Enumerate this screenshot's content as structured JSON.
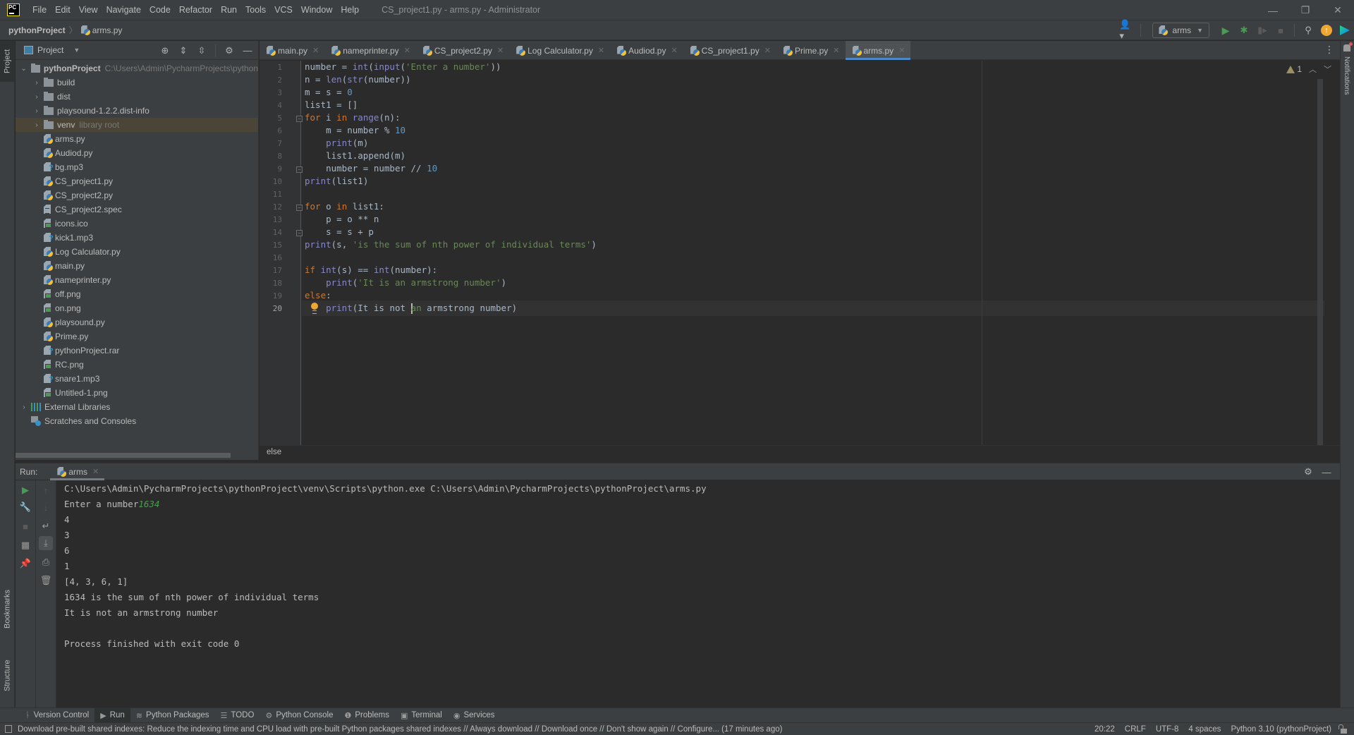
{
  "app": {
    "logo_text": "PC",
    "window_title": "CS_project1.py - arms.py - Administrator",
    "menu": [
      "File",
      "Edit",
      "View",
      "Navigate",
      "Code",
      "Refactor",
      "Run",
      "Tools",
      "VCS",
      "Window",
      "Help"
    ],
    "window_controls": {
      "minimize": "—",
      "restore": "❐",
      "close": "✕"
    }
  },
  "navbar": {
    "project": "pythonProject",
    "file": "arms.py",
    "run_config": "arms",
    "icons": [
      "account-icon",
      "run-icon",
      "debug-icon",
      "coverage-icon",
      "stop-icon",
      "search-icon",
      "update-icon",
      "code-with-me-icon"
    ]
  },
  "side_stripes": {
    "project": "Project",
    "bookmarks": "Bookmarks",
    "structure": "Structure",
    "notifications": "Notifications"
  },
  "project_panel": {
    "title": "Project",
    "root": {
      "name": "pythonProject",
      "path": "C:\\Users\\Admin\\PycharmProjects\\python"
    },
    "folders": [
      {
        "name": "build",
        "hint": ""
      },
      {
        "name": "dist",
        "hint": ""
      },
      {
        "name": "playsound-1.2.2.dist-info",
        "hint": ""
      },
      {
        "name": "venv",
        "hint": "library root"
      }
    ],
    "files": [
      {
        "name": "arms.py",
        "type": "py"
      },
      {
        "name": "Audiod.py",
        "type": "py"
      },
      {
        "name": "bg.mp3",
        "type": "unknown"
      },
      {
        "name": "CS_project1.py",
        "type": "py"
      },
      {
        "name": "CS_project2.py",
        "type": "py"
      },
      {
        "name": "CS_project2.spec",
        "type": "text"
      },
      {
        "name": "icons.ico",
        "type": "image"
      },
      {
        "name": "kick1.mp3",
        "type": "unknown"
      },
      {
        "name": "Log Calculator.py",
        "type": "py"
      },
      {
        "name": "main.py",
        "type": "py"
      },
      {
        "name": "nameprinter.py",
        "type": "py"
      },
      {
        "name": "off.png",
        "type": "image"
      },
      {
        "name": "on.png",
        "type": "image"
      },
      {
        "name": "playsound.py",
        "type": "py"
      },
      {
        "name": "Prime.py",
        "type": "py"
      },
      {
        "name": "pythonProject.rar",
        "type": "unknown"
      },
      {
        "name": "RC.png",
        "type": "image"
      },
      {
        "name": "snare1.mp3",
        "type": "unknown"
      },
      {
        "name": "Untitled-1.png",
        "type": "image"
      }
    ],
    "external_libraries": "External Libraries",
    "scratches": "Scratches and Consoles"
  },
  "editor": {
    "tabs": [
      {
        "label": "main.py",
        "active": false
      },
      {
        "label": "nameprinter.py",
        "active": false
      },
      {
        "label": "CS_project2.py",
        "active": false
      },
      {
        "label": "Log Calculator.py",
        "active": false
      },
      {
        "label": "Audiod.py",
        "active": false
      },
      {
        "label": "CS_project1.py",
        "active": false
      },
      {
        "label": "Prime.py",
        "active": false
      },
      {
        "label": "arms.py",
        "active": true
      }
    ],
    "warnings_count": "1",
    "current_line": 20,
    "lines": [
      "number = int(input('Enter a number'))",
      "n = len(str(number))",
      "m = s = 0",
      "list1 = []",
      "for i in range(n):",
      "    m = number % 10",
      "    print(m)",
      "    list1.append(m)",
      "    number = number // 10",
      "print(list1)",
      "",
      "for o in list1:",
      "    p = o ** n",
      "    s = s + p",
      "print(s, 'is the sum of nth power of individual terms')",
      "",
      "if int(s) == int(number):",
      "    print('It is an armstrong number')",
      "else:",
      "    print('It is not an armstrong number')"
    ],
    "breadcrumb": "else"
  },
  "run_panel": {
    "label": "Run:",
    "tab": "arms",
    "command": "C:\\Users\\Admin\\PycharmProjects\\pythonProject\\venv\\Scripts\\python.exe C:\\Users\\Admin\\PycharmProjects\\pythonProject\\arms.py",
    "prompt": "Enter a number",
    "input_value": "1634",
    "output": [
      "4",
      "3",
      "6",
      "1",
      "[4, 3, 6, 1]",
      "1634 is the sum of nth power of individual terms",
      "It is not an armstrong number",
      "",
      "Process finished with exit code 0"
    ]
  },
  "tool_windows": [
    {
      "label": "Version Control",
      "icon": "ᚿ",
      "active": false
    },
    {
      "label": "Run",
      "icon": "▶",
      "active": true
    },
    {
      "label": "Python Packages",
      "icon": "≋",
      "active": false
    },
    {
      "label": "TODO",
      "icon": "☰",
      "active": false
    },
    {
      "label": "Python Console",
      "icon": "⚙",
      "active": false
    },
    {
      "label": "Problems",
      "icon": "❶",
      "active": false
    },
    {
      "label": "Terminal",
      "icon": "▣",
      "active": false
    },
    {
      "label": "Services",
      "icon": "◉",
      "active": false
    }
  ],
  "statusbar": {
    "message": "Download pre-built shared indexes: Reduce the indexing time and CPU load with pre-built Python packages shared indexes // Always download // Download once // Don't show again // Configure... (17 minutes ago)",
    "position": "20:22",
    "line_sep": "CRLF",
    "encoding": "UTF-8",
    "indent": "4 spaces",
    "interpreter": "Python 3.10 (pythonProject)"
  }
}
